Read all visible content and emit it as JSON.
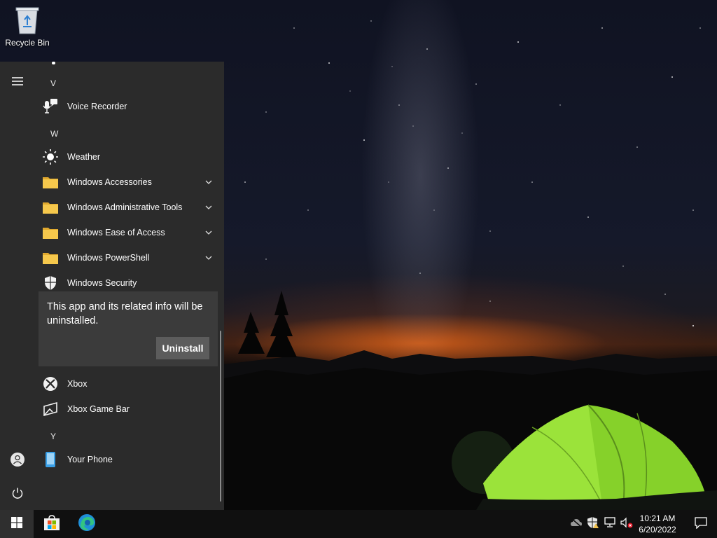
{
  "desktop": {
    "icons": [
      {
        "label": "Recycle Bin",
        "icon": "recycle-bin-icon"
      }
    ]
  },
  "start_menu": {
    "rail": {
      "menu": "hamburger-menu-icon",
      "user": "user-account-icon",
      "power": "power-icon"
    },
    "sections": [
      {
        "letter": "V"
      },
      {
        "letter": "W"
      },
      {
        "letter": "Y"
      }
    ],
    "apps": {
      "voice_recorder": {
        "name": "Voice Recorder",
        "icon": "microphone-icon"
      },
      "weather": {
        "name": "Weather",
        "icon": "sun-icon"
      },
      "windows_accessories": {
        "name": "Windows Accessories",
        "icon": "folder-icon"
      },
      "windows_admin_tools": {
        "name": "Windows Administrative Tools",
        "icon": "folder-icon"
      },
      "windows_ease_of_access": {
        "name": "Windows Ease of Access",
        "icon": "folder-icon"
      },
      "windows_powershell": {
        "name": "Windows PowerShell",
        "icon": "folder-icon"
      },
      "windows_security": {
        "name": "Windows Security",
        "icon": "shield-icon"
      },
      "xbox": {
        "name": "Xbox",
        "icon": "xbox-icon"
      },
      "xbox_game_bar": {
        "name": "Xbox Game Bar",
        "icon": "xbox-game-bar-icon"
      },
      "your_phone": {
        "name": "Your Phone",
        "icon": "phone-icon"
      }
    },
    "flyout": {
      "message": "This app and its related info will be uninstalled.",
      "button": "Uninstall"
    }
  },
  "taskbar": {
    "start": "windows-start-icon",
    "pinned": [
      "microsoft-store-icon",
      "edge-browser-icon"
    ],
    "tray": [
      "onedrive-icon",
      "security-warning-icon",
      "network-icon",
      "volume-muted-icon"
    ],
    "clock": {
      "time": "10:21 AM",
      "date": "6/20/2022"
    },
    "notifications": "notification-center-icon"
  },
  "colors": {
    "menu_bg": "#2b2b2b",
    "flyout_bg": "#3b3b3b",
    "button_bg": "#5c5c5c",
    "taskbar_bg": "#101010",
    "folder": "#f2c14e",
    "edge_blue": "#1f8fd8",
    "tent_green": "#7ed321"
  }
}
